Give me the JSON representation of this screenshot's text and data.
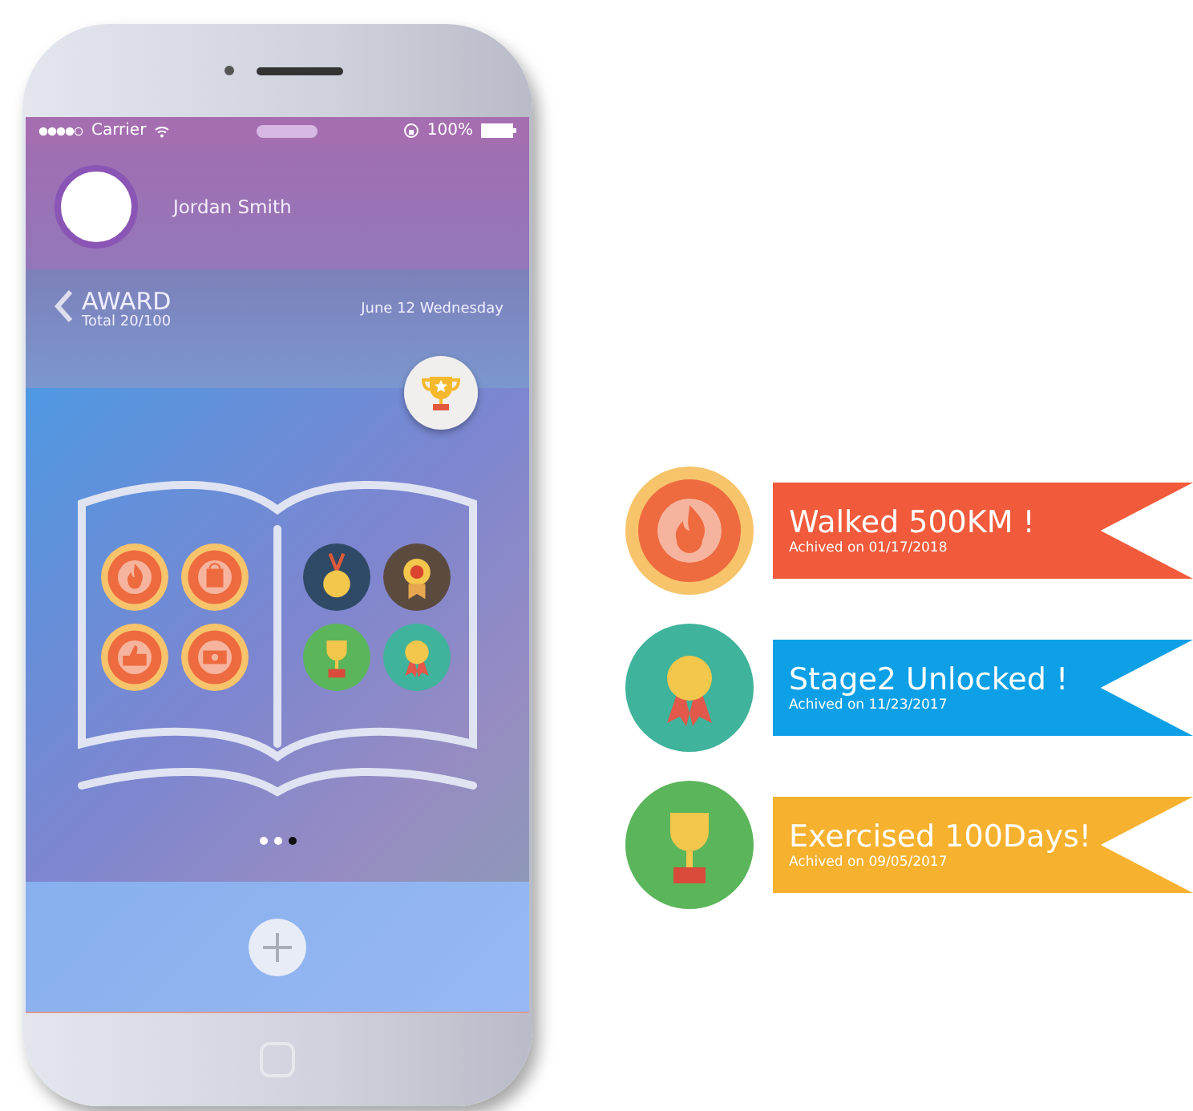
{
  "status_bar": {
    "carrier": "Carrier",
    "battery": "100%"
  },
  "profile": {
    "name": "Jordan Smith"
  },
  "header": {
    "title": "AWARD",
    "subtitle": "Total 20/100",
    "date": "June 12 Wednesday"
  },
  "book": {
    "left_badges": [
      {
        "kind": "flame"
      },
      {
        "kind": "bag"
      },
      {
        "kind": "thumb"
      },
      {
        "kind": "money"
      }
    ],
    "right_badges": [
      {
        "kind": "medal"
      },
      {
        "kind": "rosette"
      },
      {
        "kind": "trophy"
      },
      {
        "kind": "ribbon"
      }
    ]
  },
  "pager": [
    {
      "selected": false
    },
    {
      "selected": false
    },
    {
      "selected": true
    }
  ],
  "achievements": [
    {
      "kind": "flame",
      "title": "Walked 500KM !",
      "date": "Achived on 01/17/2018",
      "color": "#f15a3b"
    },
    {
      "kind": "ribbon",
      "title": "Stage2 Unlocked !",
      "date": "Achived on 11/23/2017",
      "color": "#0ea0e6"
    },
    {
      "kind": "trophy",
      "title": "Exercised 100Days!",
      "date": "Achived on 09/05/2017",
      "color": "#f6b12e"
    }
  ]
}
